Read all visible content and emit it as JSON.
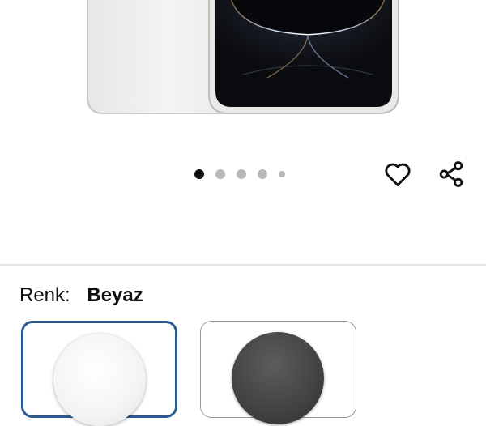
{
  "product": {
    "color_label": "Renk:",
    "selected_color": "Beyaz"
  },
  "carousel": {
    "dot_count": 5,
    "active_index": 0
  },
  "icons": {
    "wishlist": "heart-outline-icon",
    "share": "share-icon"
  },
  "colors": {
    "selected_border": "#2a5b91",
    "swatch_white": "#f4f4f4",
    "swatch_dark": "#3e4042"
  },
  "swatches": [
    {
      "color": "white",
      "selected": true
    },
    {
      "color": "dark-gray",
      "selected": false
    }
  ]
}
